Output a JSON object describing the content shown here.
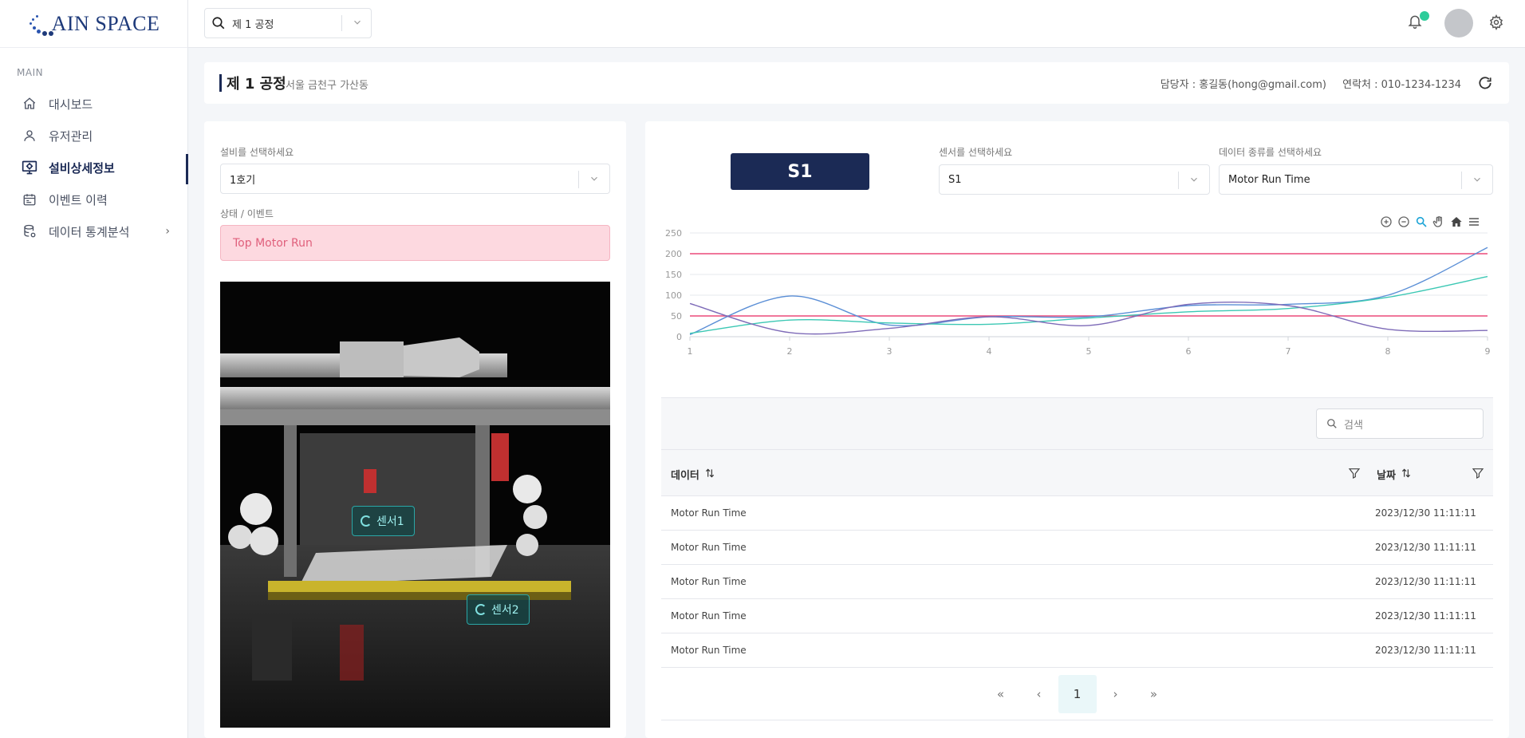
{
  "brand": {
    "logo_text": "AIN SPACE"
  },
  "sidebar": {
    "section": "MAIN",
    "items": [
      {
        "label": "대시보드",
        "icon": "home-icon"
      },
      {
        "label": "유저관리",
        "icon": "user-icon"
      },
      {
        "label": "설비상세정보",
        "icon": "monitor-icon",
        "active": true
      },
      {
        "label": "이벤트 이력",
        "icon": "calendar-icon"
      },
      {
        "label": "데이터 통계분석",
        "icon": "database-icon",
        "has_children": true
      }
    ]
  },
  "topbar": {
    "factory_select": "제 1 공정"
  },
  "header": {
    "title": "제 1 공정",
    "subtitle": "서울 금천구 가산동",
    "manager": "담당자 : 홍길동(hong@gmail.com)",
    "contact": "연락처 : 010-1234-1234"
  },
  "left": {
    "equipment_label": "설비를 선택하세요",
    "equipment_value": "1호기",
    "status_label": "상태 / 이벤트",
    "status_value": "Top Motor Run",
    "sensor_tags": [
      "센서1",
      "센서2"
    ]
  },
  "right": {
    "badge": "S1",
    "sensor_label": "센서를 선택하세요",
    "sensor_value": "S1",
    "datatype_label": "데이터 종류를 선택하세요",
    "datatype_value": "Motor Run Time"
  },
  "chart_data": {
    "type": "line",
    "x": [
      1,
      2,
      3,
      4,
      5,
      6,
      7,
      8,
      9
    ],
    "ylim": [
      0,
      250
    ],
    "yticks": [
      0,
      50,
      100,
      150,
      200,
      250
    ],
    "series": [
      {
        "color": "#5b8fd6",
        "values": [
          5,
          98,
          28,
          48,
          48,
          75,
          78,
          100,
          215
        ]
      },
      {
        "color": "#3cc8b4",
        "values": [
          8,
          40,
          33,
          30,
          45,
          60,
          68,
          95,
          145
        ]
      },
      {
        "color": "#7e6bb8",
        "values": [
          80,
          10,
          20,
          48,
          27,
          78,
          75,
          18,
          15
        ]
      }
    ],
    "thresholds": [
      {
        "value": 200,
        "color": "#ec4a7a"
      },
      {
        "value": 50,
        "color": "#ec4a7a"
      }
    ]
  },
  "table": {
    "search_placeholder": "검색",
    "col_data": "데이터",
    "col_date": "날짜",
    "rows": [
      {
        "data": "Motor Run Time",
        "date": "2023/12/30 11:11:11"
      },
      {
        "data": "Motor Run Time",
        "date": "2023/12/30 11:11:11"
      },
      {
        "data": "Motor Run Time",
        "date": "2023/12/30 11:11:11"
      },
      {
        "data": "Motor Run Time",
        "date": "2023/12/30 11:11:11"
      },
      {
        "data": "Motor Run Time",
        "date": "2023/12/30 11:11:11"
      }
    ],
    "page": "1"
  }
}
